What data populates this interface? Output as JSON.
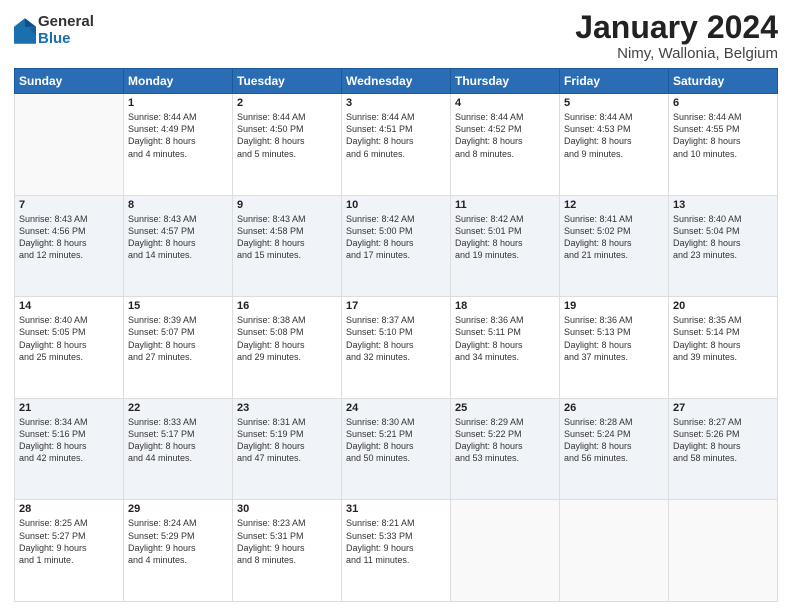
{
  "header": {
    "logo": {
      "general": "General",
      "blue": "Blue"
    },
    "title": "January 2024",
    "subtitle": "Nimy, Wallonia, Belgium"
  },
  "calendar": {
    "days_of_week": [
      "Sunday",
      "Monday",
      "Tuesday",
      "Wednesday",
      "Thursday",
      "Friday",
      "Saturday"
    ],
    "weeks": [
      [
        {
          "day": "",
          "info": ""
        },
        {
          "day": "1",
          "info": "Sunrise: 8:44 AM\nSunset: 4:49 PM\nDaylight: 8 hours\nand 4 minutes."
        },
        {
          "day": "2",
          "info": "Sunrise: 8:44 AM\nSunset: 4:50 PM\nDaylight: 8 hours\nand 5 minutes."
        },
        {
          "day": "3",
          "info": "Sunrise: 8:44 AM\nSunset: 4:51 PM\nDaylight: 8 hours\nand 6 minutes."
        },
        {
          "day": "4",
          "info": "Sunrise: 8:44 AM\nSunset: 4:52 PM\nDaylight: 8 hours\nand 8 minutes."
        },
        {
          "day": "5",
          "info": "Sunrise: 8:44 AM\nSunset: 4:53 PM\nDaylight: 8 hours\nand 9 minutes."
        },
        {
          "day": "6",
          "info": "Sunrise: 8:44 AM\nSunset: 4:55 PM\nDaylight: 8 hours\nand 10 minutes."
        }
      ],
      [
        {
          "day": "7",
          "info": "Sunrise: 8:43 AM\nSunset: 4:56 PM\nDaylight: 8 hours\nand 12 minutes."
        },
        {
          "day": "8",
          "info": "Sunrise: 8:43 AM\nSunset: 4:57 PM\nDaylight: 8 hours\nand 14 minutes."
        },
        {
          "day": "9",
          "info": "Sunrise: 8:43 AM\nSunset: 4:58 PM\nDaylight: 8 hours\nand 15 minutes."
        },
        {
          "day": "10",
          "info": "Sunrise: 8:42 AM\nSunset: 5:00 PM\nDaylight: 8 hours\nand 17 minutes."
        },
        {
          "day": "11",
          "info": "Sunrise: 8:42 AM\nSunset: 5:01 PM\nDaylight: 8 hours\nand 19 minutes."
        },
        {
          "day": "12",
          "info": "Sunrise: 8:41 AM\nSunset: 5:02 PM\nDaylight: 8 hours\nand 21 minutes."
        },
        {
          "day": "13",
          "info": "Sunrise: 8:40 AM\nSunset: 5:04 PM\nDaylight: 8 hours\nand 23 minutes."
        }
      ],
      [
        {
          "day": "14",
          "info": "Sunrise: 8:40 AM\nSunset: 5:05 PM\nDaylight: 8 hours\nand 25 minutes."
        },
        {
          "day": "15",
          "info": "Sunrise: 8:39 AM\nSunset: 5:07 PM\nDaylight: 8 hours\nand 27 minutes."
        },
        {
          "day": "16",
          "info": "Sunrise: 8:38 AM\nSunset: 5:08 PM\nDaylight: 8 hours\nand 29 minutes."
        },
        {
          "day": "17",
          "info": "Sunrise: 8:37 AM\nSunset: 5:10 PM\nDaylight: 8 hours\nand 32 minutes."
        },
        {
          "day": "18",
          "info": "Sunrise: 8:36 AM\nSunset: 5:11 PM\nDaylight: 8 hours\nand 34 minutes."
        },
        {
          "day": "19",
          "info": "Sunrise: 8:36 AM\nSunset: 5:13 PM\nDaylight: 8 hours\nand 37 minutes."
        },
        {
          "day": "20",
          "info": "Sunrise: 8:35 AM\nSunset: 5:14 PM\nDaylight: 8 hours\nand 39 minutes."
        }
      ],
      [
        {
          "day": "21",
          "info": "Sunrise: 8:34 AM\nSunset: 5:16 PM\nDaylight: 8 hours\nand 42 minutes."
        },
        {
          "day": "22",
          "info": "Sunrise: 8:33 AM\nSunset: 5:17 PM\nDaylight: 8 hours\nand 44 minutes."
        },
        {
          "day": "23",
          "info": "Sunrise: 8:31 AM\nSunset: 5:19 PM\nDaylight: 8 hours\nand 47 minutes."
        },
        {
          "day": "24",
          "info": "Sunrise: 8:30 AM\nSunset: 5:21 PM\nDaylight: 8 hours\nand 50 minutes."
        },
        {
          "day": "25",
          "info": "Sunrise: 8:29 AM\nSunset: 5:22 PM\nDaylight: 8 hours\nand 53 minutes."
        },
        {
          "day": "26",
          "info": "Sunrise: 8:28 AM\nSunset: 5:24 PM\nDaylight: 8 hours\nand 56 minutes."
        },
        {
          "day": "27",
          "info": "Sunrise: 8:27 AM\nSunset: 5:26 PM\nDaylight: 8 hours\nand 58 minutes."
        }
      ],
      [
        {
          "day": "28",
          "info": "Sunrise: 8:25 AM\nSunset: 5:27 PM\nDaylight: 9 hours\nand 1 minute."
        },
        {
          "day": "29",
          "info": "Sunrise: 8:24 AM\nSunset: 5:29 PM\nDaylight: 9 hours\nand 4 minutes."
        },
        {
          "day": "30",
          "info": "Sunrise: 8:23 AM\nSunset: 5:31 PM\nDaylight: 9 hours\nand 8 minutes."
        },
        {
          "day": "31",
          "info": "Sunrise: 8:21 AM\nSunset: 5:33 PM\nDaylight: 9 hours\nand 11 minutes."
        },
        {
          "day": "",
          "info": ""
        },
        {
          "day": "",
          "info": ""
        },
        {
          "day": "",
          "info": ""
        }
      ]
    ]
  }
}
